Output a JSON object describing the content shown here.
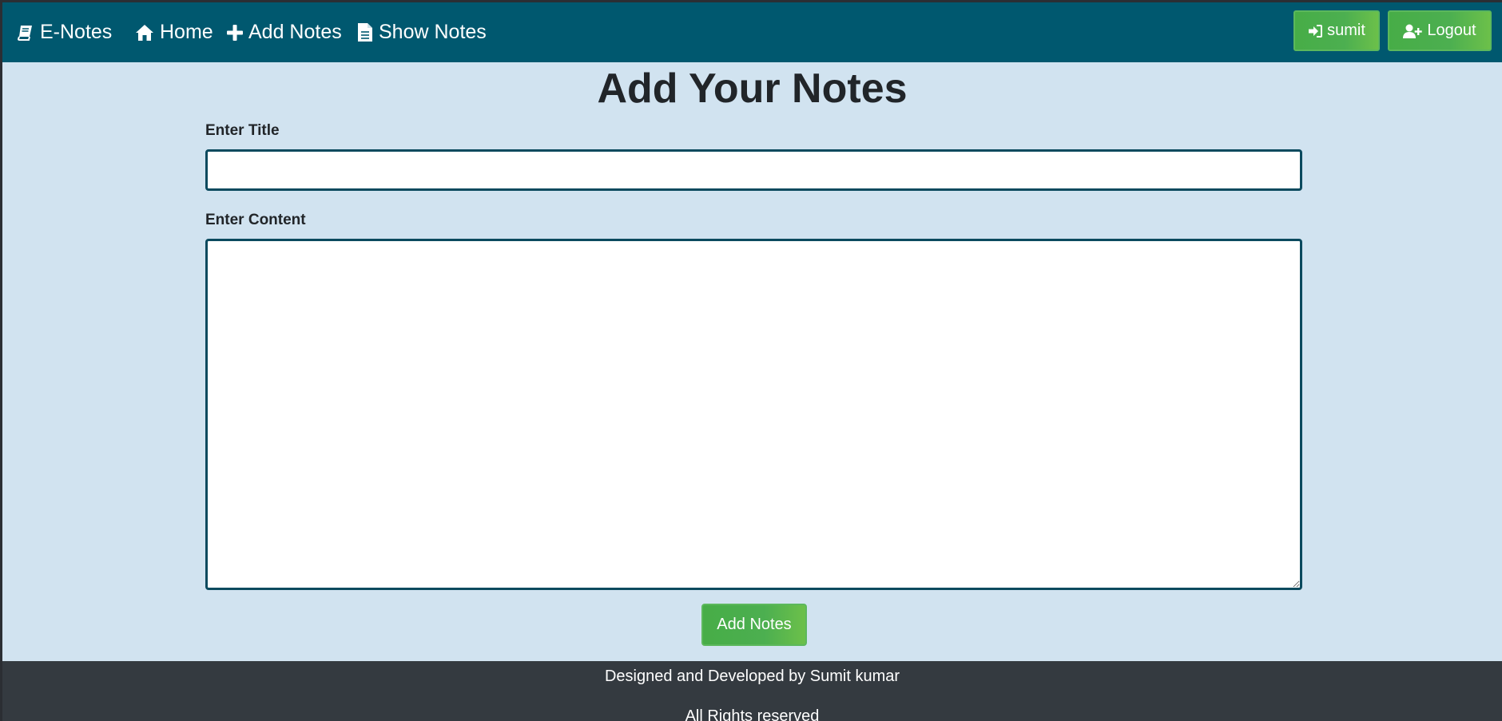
{
  "navbar": {
    "brand": {
      "label": "E-Notes",
      "icon": "book-icon"
    },
    "links": [
      {
        "label": "Home",
        "icon": "home-icon"
      },
      {
        "label": "Add Notes",
        "icon": "plus-icon"
      },
      {
        "label": "Show Notes",
        "icon": "file-text-icon"
      }
    ],
    "user_button": {
      "label": "sumit",
      "icon": "sign-in-icon"
    },
    "logout_button": {
      "label": "Logout",
      "icon": "user-plus-icon"
    }
  },
  "main": {
    "title": "Add Your Notes",
    "title_label": "Enter Title",
    "title_value": "",
    "content_label": "Enter Content",
    "content_value": "",
    "submit_label": "Add Notes"
  },
  "footer": {
    "line1": "Designed and Developed by Sumit kumar",
    "line2": "All Rights reserved"
  },
  "colors": {
    "navbar": "#00586f",
    "page_background": "#d1e3f0",
    "button_green": "#4caf50",
    "input_border": "#0b4a5e",
    "footer": "#343a40"
  }
}
